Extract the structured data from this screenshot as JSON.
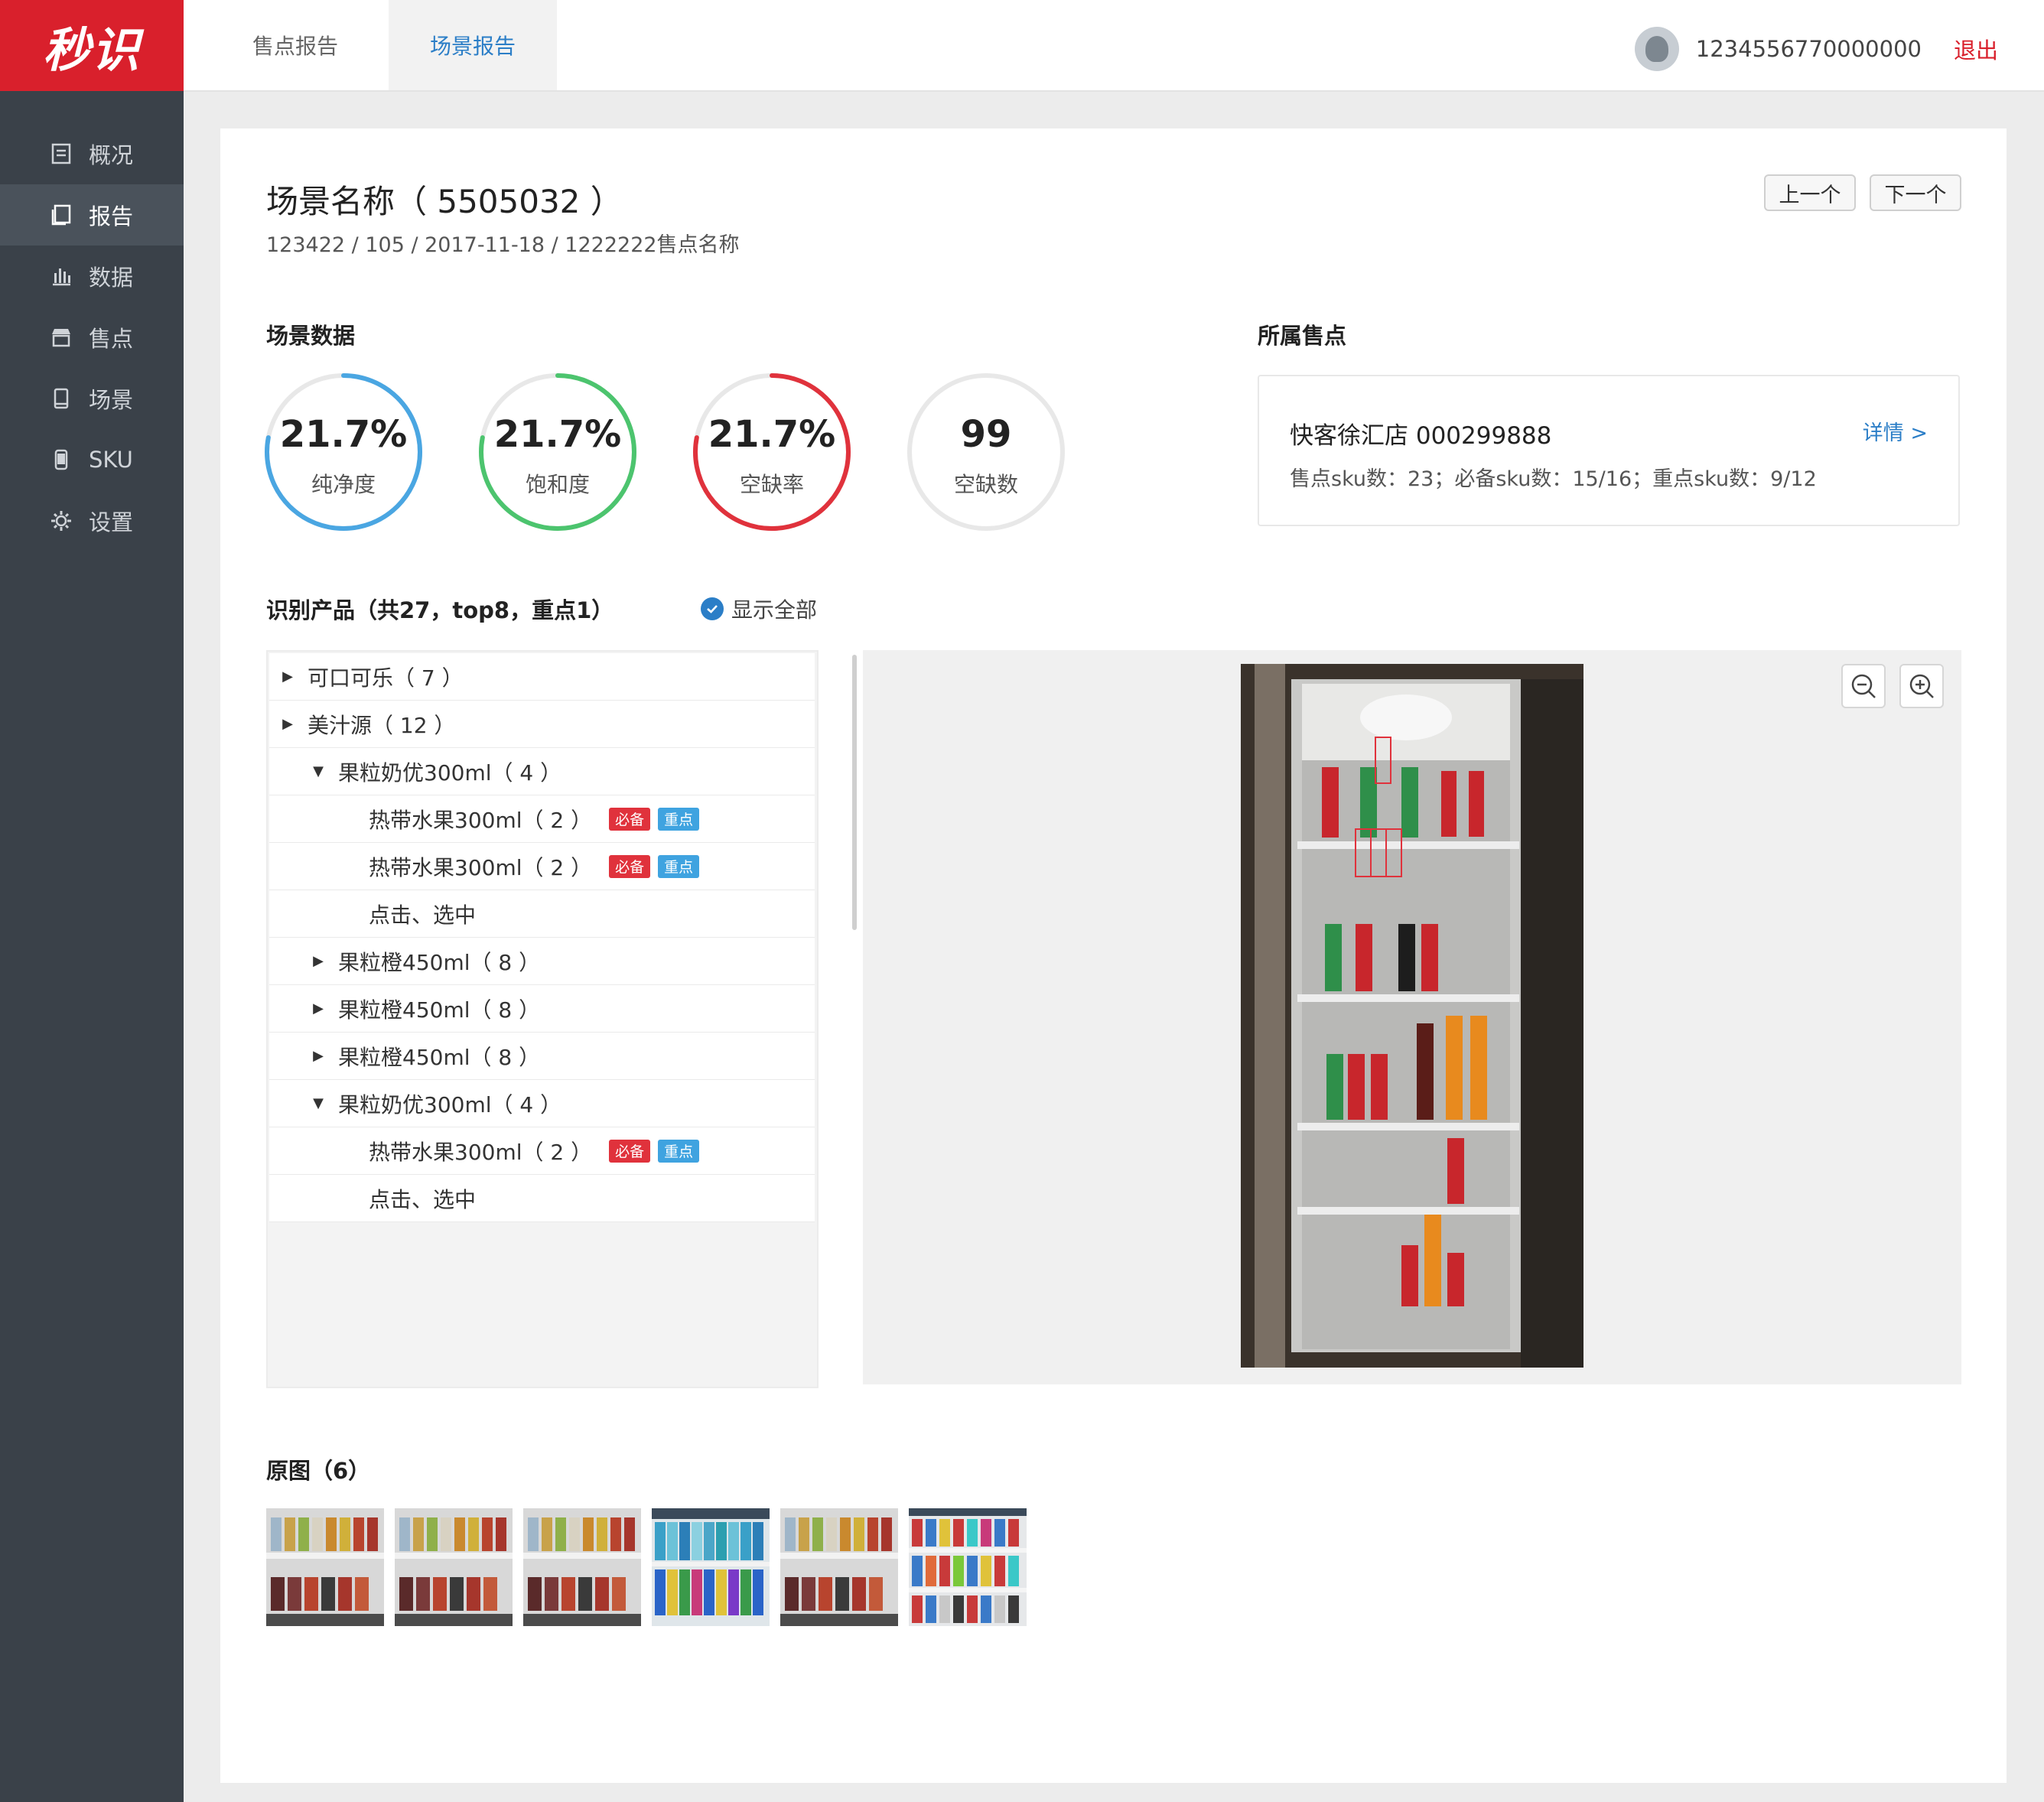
{
  "brand": {
    "logo_text": "秒识"
  },
  "sidebar": {
    "items": [
      {
        "label": "概况",
        "icon": "overview-icon"
      },
      {
        "label": "报告",
        "icon": "report-icon",
        "active": true
      },
      {
        "label": "数据",
        "icon": "bar-chart-icon"
      },
      {
        "label": "售点",
        "icon": "store-icon"
      },
      {
        "label": "场景",
        "icon": "tablet-icon"
      },
      {
        "label": "SKU",
        "icon": "phone-icon"
      },
      {
        "label": "设置",
        "icon": "gear-icon"
      }
    ]
  },
  "header": {
    "tabs": [
      {
        "label": "售点报告",
        "active": false
      },
      {
        "label": "场景报告",
        "active": true
      }
    ],
    "user_id": "1234556770000000",
    "logout_label": "退出"
  },
  "scene": {
    "title": "场景名称（ 5505032 ）",
    "meta": "123422 / 105 / 2017-11-18 / 1222222售点名称",
    "prev_label": "上一个",
    "next_label": "下一个"
  },
  "scene_data": {
    "title": "场景数据",
    "metrics": [
      {
        "value": "21.7%",
        "label": "纯净度",
        "fraction": 0.78,
        "color": "#4aa6e2"
      },
      {
        "value": "21.7%",
        "label": "饱和度",
        "fraction": 0.78,
        "color": "#4cc46e"
      },
      {
        "value": "21.7%",
        "label": "空缺率",
        "fraction": 0.78,
        "color": "#e0323c"
      },
      {
        "value": "99",
        "label": "空缺数",
        "fraction": 0,
        "color": "#e8e8e8"
      }
    ]
  },
  "outlet": {
    "title": "所属售点",
    "name": "快客徐汇店 000299888",
    "detail_label": "详情 >",
    "info": "售点sku数：23；必备sku数：15/16；重点sku数：9/12"
  },
  "products": {
    "title": "识别产品（共27，top8，重点1）",
    "show_all_label": "显示全部",
    "rows": [
      {
        "level": 0,
        "caret": "right",
        "text": "可口可乐（ 7 ）"
      },
      {
        "level": 0,
        "caret": "right",
        "text": "美汁源（ 12 ）"
      },
      {
        "level": 1,
        "caret": "down",
        "text": "果粒奶优300ml（ 4 ）"
      },
      {
        "level": 2,
        "caret": "",
        "text": "热带水果300ml（ 2 ）",
        "tags": [
          "必备",
          "重点"
        ]
      },
      {
        "level": 2,
        "caret": "",
        "text": "热带水果300ml（ 2 ）",
        "tags": [
          "必备",
          "重点"
        ]
      },
      {
        "level": 2,
        "caret": "",
        "text": "点击、选中"
      },
      {
        "level": 1,
        "caret": "right",
        "text": "果粒橙450ml（ 8 ）"
      },
      {
        "level": 1,
        "caret": "right",
        "text": "果粒橙450ml（ 8 ）"
      },
      {
        "level": 1,
        "caret": "right",
        "text": "果粒橙450ml（ 8 ）"
      },
      {
        "level": 1,
        "caret": "down",
        "text": "果粒奶优300ml（ 4 ）"
      },
      {
        "level": 2,
        "caret": "",
        "text": "热带水果300ml（ 2 ）",
        "tags": [
          "必备",
          "重点"
        ]
      },
      {
        "level": 2,
        "caret": "",
        "text": "点击、选中"
      }
    ]
  },
  "viewer": {
    "zoom_out_icon": "zoom-out-icon",
    "zoom_in_icon": "zoom-in-icon"
  },
  "originals": {
    "title": "原图（6）",
    "count": 6
  }
}
